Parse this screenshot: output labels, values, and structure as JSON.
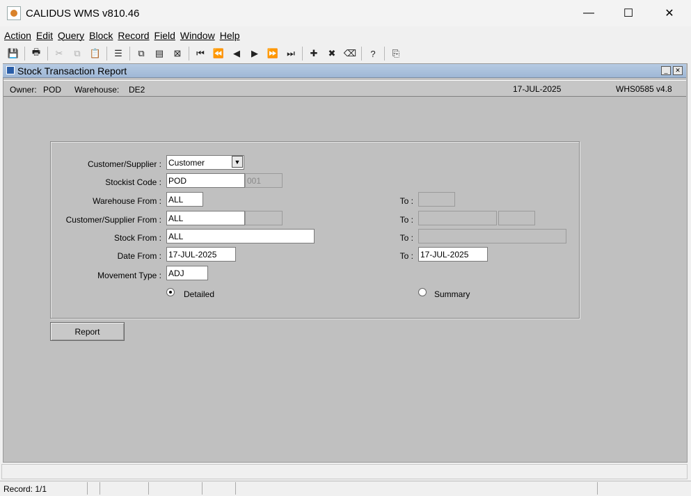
{
  "window": {
    "title": "CALIDUS WMS v810.46",
    "minimize": "—",
    "maximize": "☐",
    "close": "✕"
  },
  "menu": [
    {
      "label": "Action"
    },
    {
      "label": "Edit"
    },
    {
      "label": "Query"
    },
    {
      "label": "Block"
    },
    {
      "label": "Record"
    },
    {
      "label": "Field"
    },
    {
      "label": "Window"
    },
    {
      "label": "Help"
    }
  ],
  "toolbar": [
    {
      "icon": "save-icon",
      "glyph": "💾",
      "enabled": true
    },
    {
      "icon": "print-icon",
      "glyph": "🖶",
      "enabled": true
    },
    {
      "icon": "cut-icon",
      "glyph": "✂",
      "enabled": false
    },
    {
      "icon": "copy-icon",
      "glyph": "⧉",
      "enabled": false
    },
    {
      "icon": "paste-icon",
      "glyph": "📋",
      "enabled": false
    },
    {
      "icon": "list-icon",
      "glyph": "☰",
      "enabled": true
    },
    {
      "icon": "enter-query-icon",
      "glyph": "⧉",
      "enabled": true
    },
    {
      "icon": "execute-query-icon",
      "glyph": "▤",
      "enabled": true
    },
    {
      "icon": "cancel-query-icon",
      "glyph": "⊠",
      "enabled": true
    },
    {
      "icon": "first-record-icon",
      "glyph": "⏮",
      "enabled": true
    },
    {
      "icon": "previous-block-icon",
      "glyph": "⏪",
      "enabled": true
    },
    {
      "icon": "previous-record-icon",
      "glyph": "◀",
      "enabled": true
    },
    {
      "icon": "next-record-icon",
      "glyph": "▶",
      "enabled": true
    },
    {
      "icon": "next-block-icon",
      "glyph": "⏩",
      "enabled": true
    },
    {
      "icon": "last-record-icon",
      "glyph": "⏭",
      "enabled": true
    },
    {
      "icon": "insert-record-icon",
      "glyph": "✚",
      "enabled": true
    },
    {
      "icon": "delete-record-icon",
      "glyph": "✖",
      "enabled": true
    },
    {
      "icon": "clear-record-icon",
      "glyph": "⌫",
      "enabled": true
    },
    {
      "icon": "help-icon",
      "glyph": "?",
      "enabled": true
    },
    {
      "icon": "exit-icon",
      "glyph": "⎘",
      "enabled": true
    }
  ],
  "form": {
    "title": "Stock Transaction Report",
    "owner_label": "Owner:",
    "owner_value": "POD",
    "warehouse_label": "Warehouse:",
    "warehouse_value": "DE2",
    "date": "17-JUL-2025",
    "version": "WHS0585  v4.8"
  },
  "fields": {
    "customer_supplier_label": "Customer/Supplier :",
    "customer_supplier_value": "Customer",
    "stockist_code_label": "Stockist Code :",
    "stockist_code_value": "POD",
    "stockist_code_secondary": "001",
    "warehouse_from_label": "Warehouse  From :",
    "warehouse_from_value": "ALL",
    "warehouse_to_label": "To :",
    "warehouse_to_value": "",
    "cs_from_label": "Customer/Supplier From :",
    "cs_from_value": "ALL",
    "cs_from_secondary": "",
    "cs_to_label": "To :",
    "cs_to_value": "",
    "cs_to_secondary": "",
    "stock_from_label": "Stock From :",
    "stock_from_value": "ALL",
    "stock_to_label": "To :",
    "stock_to_value": "",
    "date_from_label": "Date From :",
    "date_from_value": "17-JUL-2025",
    "date_to_label": "To :",
    "date_to_value": "17-JUL-2025",
    "movement_type_label": "Movement Type :",
    "movement_type_value": "ADJ",
    "detailed_label": "Detailed",
    "summary_label": "Summary",
    "selected_mode": "Detailed"
  },
  "actions": {
    "report_label": "Report"
  },
  "status": {
    "record": "Record: 1/1"
  }
}
